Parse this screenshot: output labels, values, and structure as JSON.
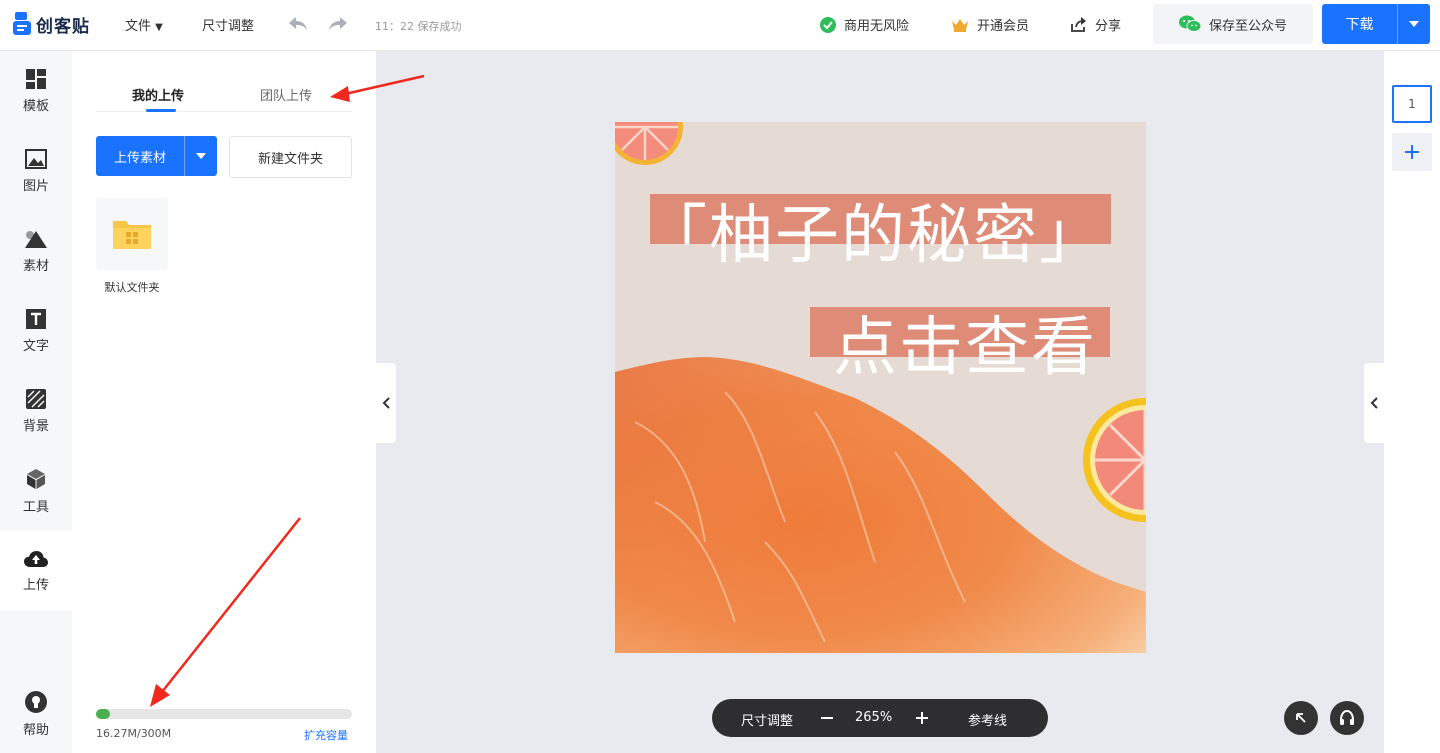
{
  "brand": {
    "logo_text": "创客贴"
  },
  "header": {
    "file_menu": "文件",
    "resize": "尺寸调整",
    "save_status": "11：22 保存成功",
    "commercial": "商用无风险",
    "vip": "开通会员",
    "share": "分享",
    "save_wechat": "保存至公众号",
    "download": "下载"
  },
  "sidebar": {
    "items": [
      {
        "label": "模板",
        "icon": "template-icon"
      },
      {
        "label": "图片",
        "icon": "image-icon"
      },
      {
        "label": "素材",
        "icon": "shapes-icon"
      },
      {
        "label": "文字",
        "icon": "text-icon"
      },
      {
        "label": "背景",
        "icon": "background-icon"
      },
      {
        "label": "工具",
        "icon": "cube-icon"
      },
      {
        "label": "上传",
        "icon": "cloud-upload-icon"
      }
    ],
    "help": "帮助"
  },
  "panel": {
    "tab_mine": "我的上传",
    "tab_team": "团队上传",
    "upload_button": "上传素材",
    "new_folder_button": "新建文件夹",
    "folder_label": "默认文件夹",
    "storage_text": "16.27M/300M",
    "storage_used_fraction": 0.054,
    "expand_link": "扩充容量"
  },
  "canvas": {
    "title": "「柚子的秘密」",
    "subtitle": "点击查看"
  },
  "pages": {
    "current": "1"
  },
  "bottom_toolbar": {
    "resize": "尺寸调整",
    "zoom": "265%",
    "guides": "参考线"
  },
  "colors": {
    "accent": "#1a73ff",
    "storage_fill": "#4caf50",
    "title_band": "#de8c78"
  }
}
